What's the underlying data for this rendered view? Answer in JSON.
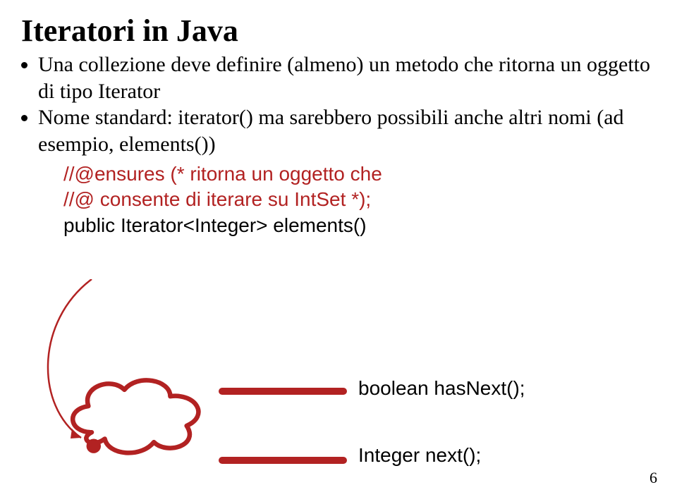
{
  "title": "Iteratori in Java",
  "bullets": [
    "Una collezione deve definire (almeno) un metodo che ritorna un oggetto di tipo Iterator",
    "Nome standard: iterator() ma sarebbero possibili anche altri nomi (ad esempio, elements())"
  ],
  "code": {
    "comment1": "//@ensures (* ritorna un oggetto che",
    "comment2": "//@  consente di iterare su IntSet *);",
    "signature": "public Iterator<Integer> elements()"
  },
  "methods": {
    "hasNext": "boolean hasNext();",
    "next": "Integer next();"
  },
  "pageNumber": "6",
  "colors": {
    "accent": "#b22222"
  }
}
